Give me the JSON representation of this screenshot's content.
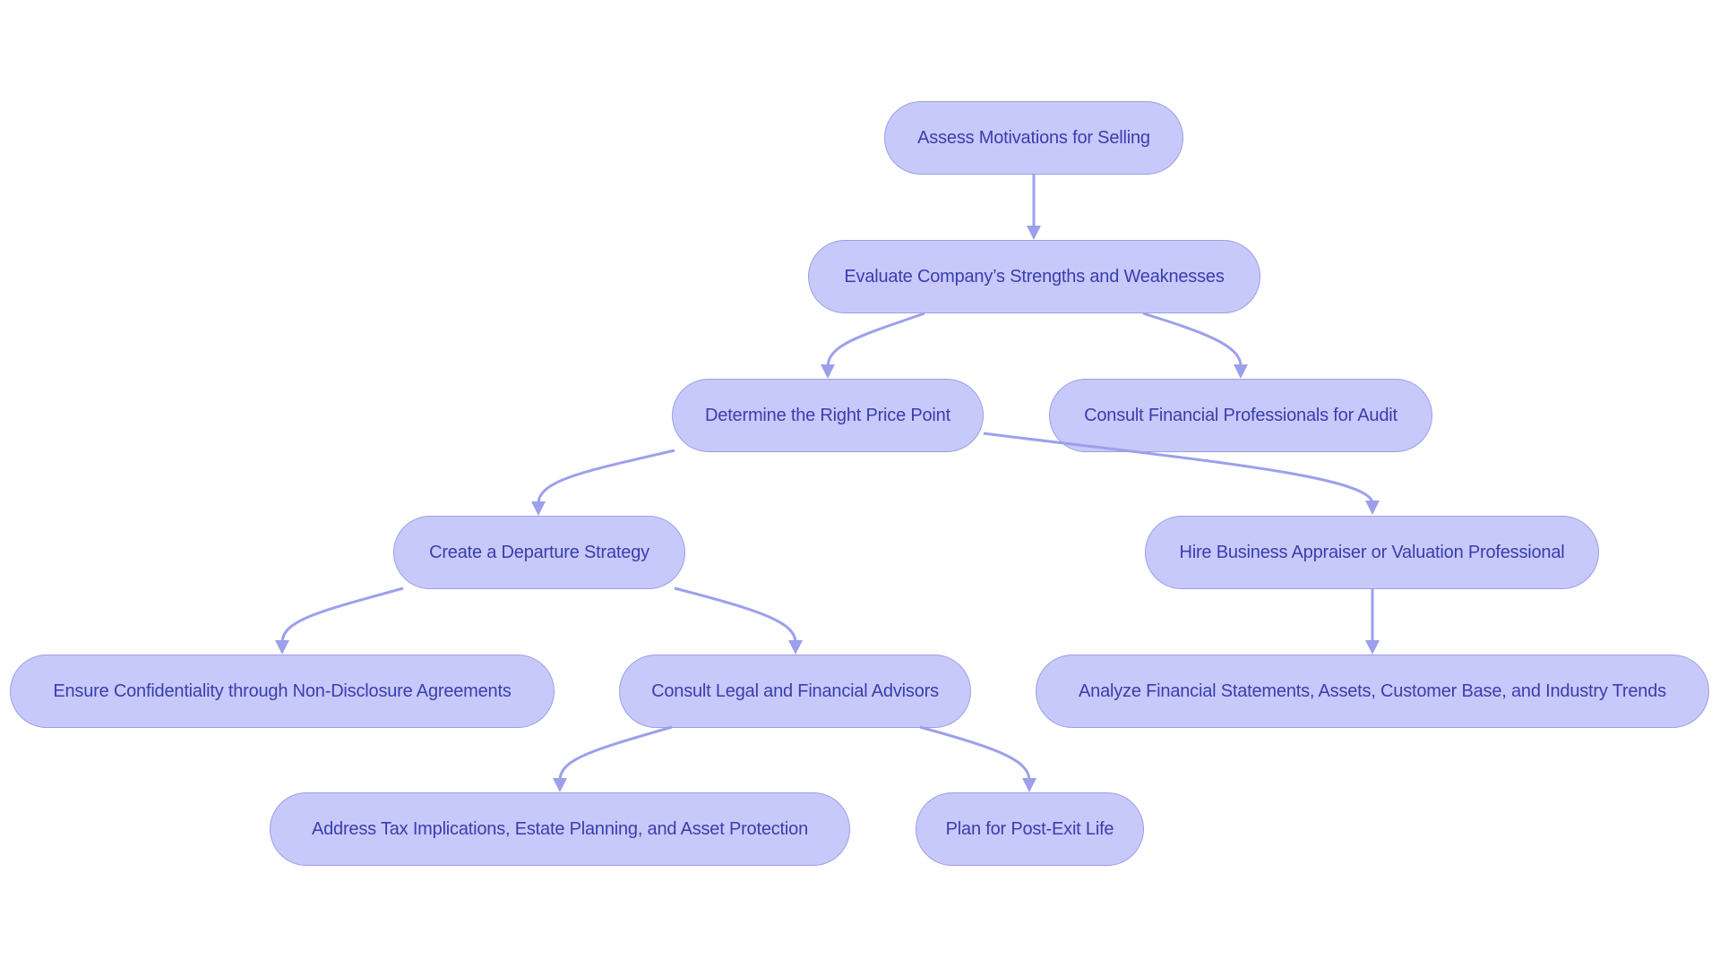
{
  "diagram": {
    "type": "flowchart",
    "direction": "top-down",
    "colors": {
      "node_fill": "#c8c9fb",
      "node_border": "#9c9fe4",
      "node_text": "#3a3dad",
      "edge": "#9ca0eb",
      "background": "#ffffff"
    },
    "nodes": [
      {
        "id": "assess",
        "label": "Assess Motivations for Selling"
      },
      {
        "id": "evaluate",
        "label": "Evaluate Company’s Strengths and Weaknesses"
      },
      {
        "id": "price",
        "label": "Determine the Right Price Point"
      },
      {
        "id": "audit",
        "label": "Consult Financial Professionals for Audit"
      },
      {
        "id": "departure",
        "label": "Create a Departure Strategy"
      },
      {
        "id": "appraiser",
        "label": "Hire Business Appraiser or Valuation Professional"
      },
      {
        "id": "nda",
        "label": "Ensure Confidentiality through Non-Disclosure Agreements"
      },
      {
        "id": "advisors",
        "label": "Consult Legal and Financial Advisors"
      },
      {
        "id": "analyze",
        "label": "Analyze Financial Statements, Assets, Customer Base, and Industry Trends"
      },
      {
        "id": "tax",
        "label": "Address Tax Implications, Estate Planning, and Asset Protection"
      },
      {
        "id": "postexit",
        "label": "Plan for Post-Exit Life"
      }
    ],
    "edges": [
      {
        "from": "assess",
        "to": "evaluate"
      },
      {
        "from": "evaluate",
        "to": "price"
      },
      {
        "from": "evaluate",
        "to": "audit"
      },
      {
        "from": "price",
        "to": "departure"
      },
      {
        "from": "price",
        "to": "appraiser"
      },
      {
        "from": "departure",
        "to": "nda"
      },
      {
        "from": "departure",
        "to": "advisors"
      },
      {
        "from": "appraiser",
        "to": "analyze"
      },
      {
        "from": "advisors",
        "to": "tax"
      },
      {
        "from": "advisors",
        "to": "postexit"
      }
    ]
  }
}
